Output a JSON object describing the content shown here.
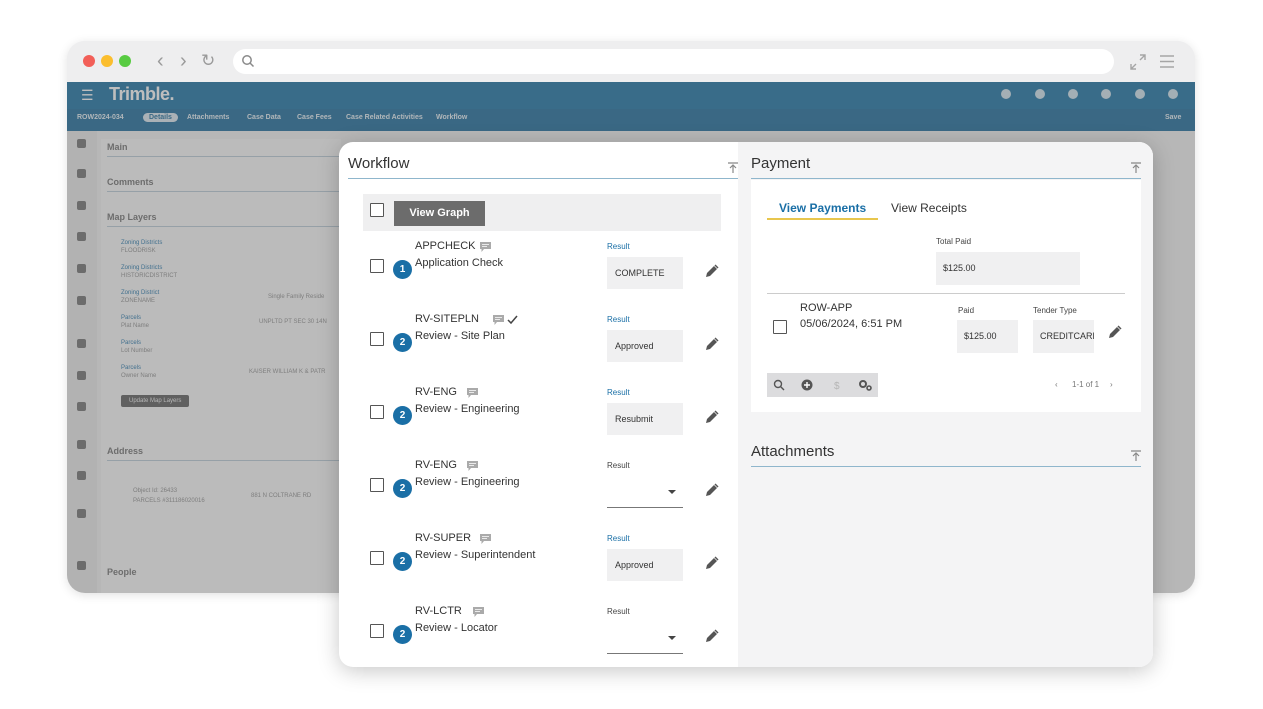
{
  "browser": {
    "back_icon": "chevron-left-icon",
    "forward_icon": "chevron-right-icon",
    "reload_icon": "reload-icon",
    "search_icon": "search-icon",
    "expand_icon": "expand-icon",
    "menu_icon": "hamburger-icon"
  },
  "app": {
    "brand": "Trimble.",
    "subnav": [
      "ROW2024-034",
      "Details",
      "Attachments",
      "Case Data",
      "Case Fees",
      "Case Related Activities",
      "Workflow"
    ],
    "subnav_right": "Save",
    "left_panel": {
      "sections": [
        "Main",
        "Comments",
        "Map Layers",
        "Address",
        "People"
      ],
      "map_rows": [
        {
          "label": "Zoning Districts",
          "value": "FLOODRISK",
          "right": ""
        },
        {
          "label": "Zoning Districts",
          "value": "HISTORICDISTRICT",
          "right": ""
        },
        {
          "label": "Zoning District",
          "value": "ZONENAME",
          "right": "Single Family Reside"
        },
        {
          "label": "Parcels",
          "value": "Plat Name",
          "right": "UNPLTD PT SEC 30 14N"
        },
        {
          "label": "Parcels",
          "value": "Lot Number",
          "right": ""
        },
        {
          "label": "Parcels",
          "value": "Owner Name",
          "right": "KAISER WILLIAM K & PATR"
        }
      ],
      "update_button": "Update Map Layers",
      "address_object": "Object Id: 26433",
      "address_parcel": "PARCELS #311186020016",
      "address_value": "881 N COLTRANE RD"
    }
  },
  "workflow": {
    "title": "Workflow",
    "view_graph_label": "View Graph",
    "steps": [
      {
        "code": "APPCHECK",
        "name": "Application Check",
        "badge": "1",
        "result_label": "Result",
        "result": "COMPLETE",
        "type": "value",
        "checked": false
      },
      {
        "code": "RV-SITEPLN",
        "name": "Review - Site Plan",
        "badge": "2",
        "result_label": "Result",
        "result": "Approved",
        "type": "value",
        "checked": true
      },
      {
        "code": "RV-ENG",
        "name": "Review - Engineering",
        "badge": "2",
        "result_label": "Result",
        "result": "Resubmit",
        "type": "value",
        "checked": false
      },
      {
        "code": "RV-ENG",
        "name": "Review - Engineering",
        "badge": "2",
        "result_label": "Result",
        "result": "",
        "type": "select",
        "checked": false
      },
      {
        "code": "RV-SUPER",
        "name": "Review - Superintendent",
        "badge": "2",
        "result_label": "Result",
        "result": "Approved",
        "type": "value",
        "checked": false
      },
      {
        "code": "RV-LCTR",
        "name": "Review - Locator",
        "badge": "2",
        "result_label": "Result",
        "result": "",
        "type": "select",
        "checked": false
      }
    ]
  },
  "payment": {
    "title": "Payment",
    "tabs": [
      {
        "label": "View Payments",
        "active": true
      },
      {
        "label": "View Receipts",
        "active": false
      }
    ],
    "total_paid_label": "Total Paid",
    "total_paid_value": "$125.00",
    "row": {
      "code": "ROW-APP",
      "date": "05/06/2024, 6:51 PM",
      "paid_label": "Paid",
      "paid_value": "$125.00",
      "tender_label": "Tender Type",
      "tender_value": "CREDITCARD"
    },
    "toolbar_icons": [
      "search-icon",
      "add-icon",
      "dollar-icon",
      "settings-icon"
    ],
    "pager": "1-1 of 1"
  },
  "attachments": {
    "title": "Attachments"
  },
  "colors": {
    "brand_header": "#0e6b9e",
    "accent_blue": "#1a6fa6",
    "tab_underline": "#e8c64d",
    "view_graph_button": "#6c6c6c"
  }
}
